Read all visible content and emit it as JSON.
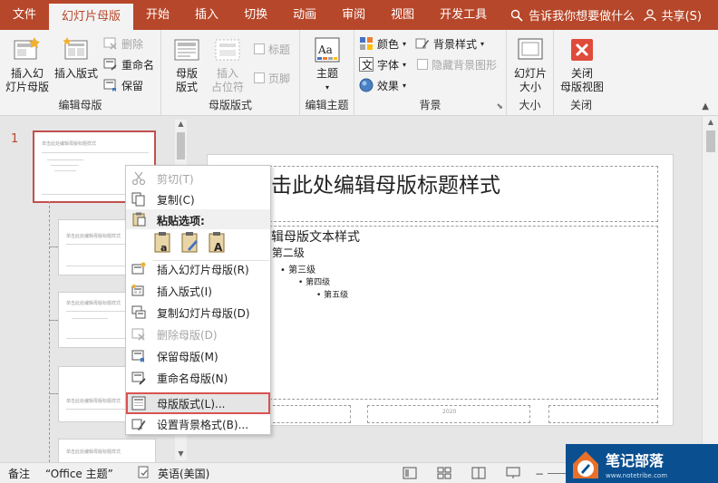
{
  "tabs": [
    "文件",
    "幻灯片母版",
    "开始",
    "插入",
    "切换",
    "动画",
    "审阅",
    "视图",
    "开发工具"
  ],
  "tell_me": "告诉我你想要做什么",
  "share": "共享(S)",
  "ribbon": {
    "edit_master": {
      "label": "编辑母版",
      "insert_master": "插入幻\n灯片母版",
      "insert_layout": "插入版式",
      "delete": "删除",
      "rename": "重命名",
      "preserve": "保留"
    },
    "master_layout": {
      "label": "母版版式",
      "master_layout_btn": "母版\n版式",
      "insert_placeholder": "插入\n占位符",
      "title_chk": "标题",
      "footer_chk": "页脚"
    },
    "edit_theme": {
      "label": "编辑主题",
      "theme": "主题"
    },
    "background": {
      "label": "背景",
      "colors": "颜色",
      "fonts": "字体",
      "effects": "效果",
      "bg_styles": "背景样式",
      "hide_bg": "隐藏背景图形"
    },
    "size": {
      "label": "大小",
      "slide_size": "幻灯片\n大小"
    },
    "close": {
      "label": "关闭",
      "close_view": "关闭\n母版视图"
    }
  },
  "slide_number": "1",
  "thumb_title": "单击此处编辑母版标题样式",
  "slide": {
    "title": "击此处编辑母版标题样式",
    "body1": "辑母版文本样式",
    "body2": "第二级",
    "body3": "第三级",
    "body4": "第四级",
    "body5": "第五级",
    "footer_date": "2020"
  },
  "context_menu": {
    "cut": "剪切(T)",
    "copy": "复制(C)",
    "paste_options": "粘贴选项:",
    "insert_master": "插入幻灯片母版(R)",
    "insert_layout": "插入版式(I)",
    "duplicate_master": "复制幻灯片母版(D)",
    "delete_master": "删除母版(D)",
    "preserve_master": "保留母版(M)",
    "rename_master": "重命名母版(N)",
    "master_layout": "母版版式(L)...",
    "format_bg": "设置背景格式(B)..."
  },
  "status": {
    "notes": "备注",
    "theme": "“Office 主题”",
    "lang": "英语(美国)"
  },
  "watermark": {
    "name": "笔记部落",
    "url": "www.notetribe.com"
  },
  "colors": {
    "accent": "#b7472a",
    "highlight_border": "#d9534f"
  }
}
